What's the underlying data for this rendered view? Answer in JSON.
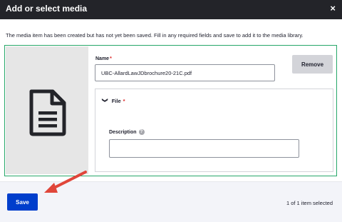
{
  "dialog": {
    "title": "Add or select media",
    "close_glyph": "×",
    "message": "The media item has been created but has not yet been saved. Fill in any required fields and save to add it to the media library."
  },
  "media_item": {
    "thumbnail_icon": "document-icon",
    "name_label": "Name",
    "required_marker": "*",
    "name_value": "UBC-AllardLawJDbrochure20-21C.pdf",
    "remove_label": "Remove",
    "file_section": {
      "chevron": "❯",
      "label": "File",
      "required_marker": "*"
    },
    "description_label": "Description",
    "help_glyph": "?",
    "description_value": ""
  },
  "footer": {
    "save_label": "Save",
    "selected_count": "1 of 1 item selected"
  },
  "colors": {
    "titlebar": "#232429",
    "save_button": "#003ecc",
    "media_border": "#26a769",
    "annotation_arrow": "#e0463a",
    "required": "#dc2323"
  }
}
